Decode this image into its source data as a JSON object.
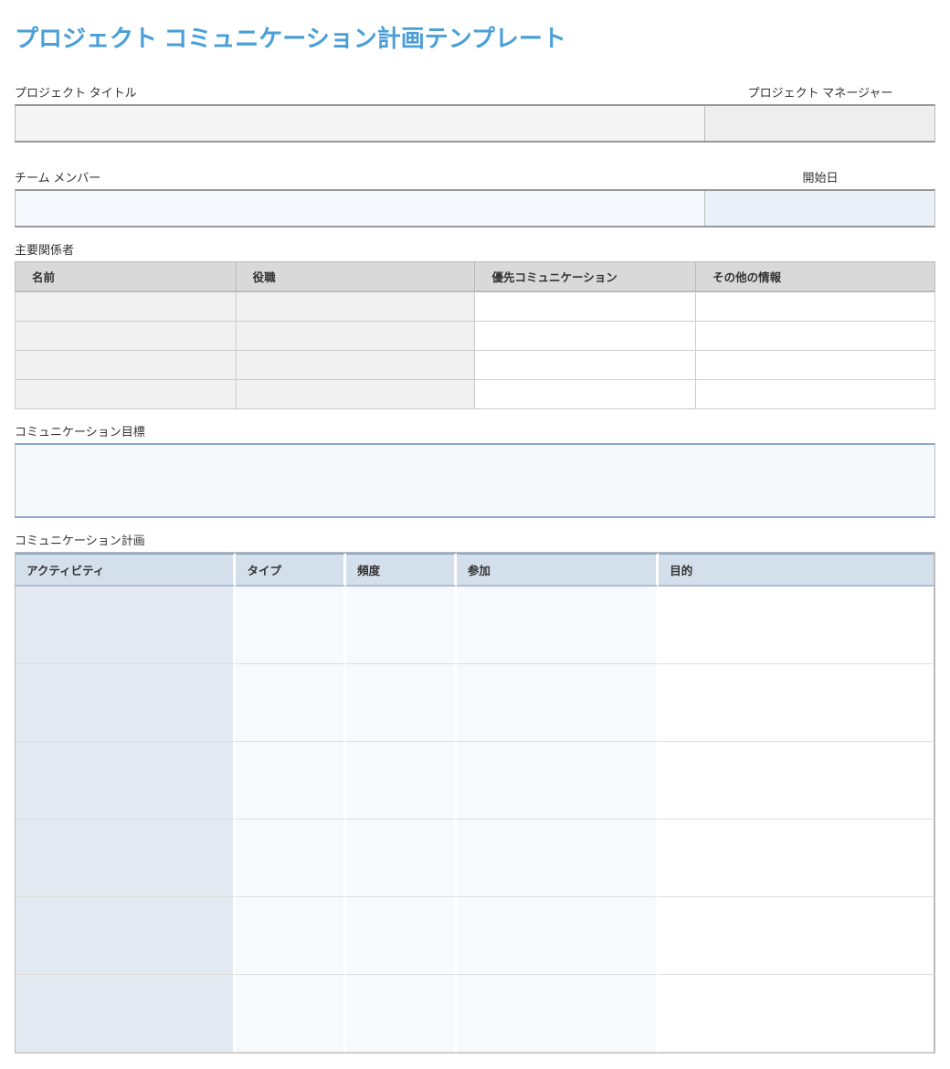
{
  "title": "プロジェクト コミュニケーション計画テンプレート",
  "labels": {
    "project_title": "プロジェクト タイトル",
    "project_manager": "プロジェクト マネージャー",
    "team_members": "チーム メンバー",
    "start_date": "開始日",
    "stakeholders": "主要関係者",
    "comm_goals": "コミュニケーション目標",
    "comm_plan": "コミュニケーション計画"
  },
  "stakeholders_table": {
    "headers": {
      "name": "名前",
      "role": "役職",
      "pref_comm": "優先コミュニケーション",
      "other": "その他の情報"
    },
    "rows": [
      {
        "name": "",
        "role": "",
        "pref_comm": "",
        "other": ""
      },
      {
        "name": "",
        "role": "",
        "pref_comm": "",
        "other": ""
      },
      {
        "name": "",
        "role": "",
        "pref_comm": "",
        "other": ""
      },
      {
        "name": "",
        "role": "",
        "pref_comm": "",
        "other": ""
      }
    ]
  },
  "plan_table": {
    "headers": {
      "activity": "アクティビティ",
      "type": "タイプ",
      "frequency": "頻度",
      "participation": "参加",
      "purpose": "目的"
    },
    "rows": [
      {
        "activity": "",
        "type": "",
        "frequency": "",
        "participation": "",
        "purpose": ""
      },
      {
        "activity": "",
        "type": "",
        "frequency": "",
        "participation": "",
        "purpose": ""
      },
      {
        "activity": "",
        "type": "",
        "frequency": "",
        "participation": "",
        "purpose": ""
      },
      {
        "activity": "",
        "type": "",
        "frequency": "",
        "participation": "",
        "purpose": ""
      },
      {
        "activity": "",
        "type": "",
        "frequency": "",
        "participation": "",
        "purpose": ""
      },
      {
        "activity": "",
        "type": "",
        "frequency": "",
        "participation": "",
        "purpose": ""
      }
    ]
  },
  "values": {
    "project_title": "",
    "project_manager": "",
    "team_members": "",
    "start_date": "",
    "comm_goals": ""
  }
}
